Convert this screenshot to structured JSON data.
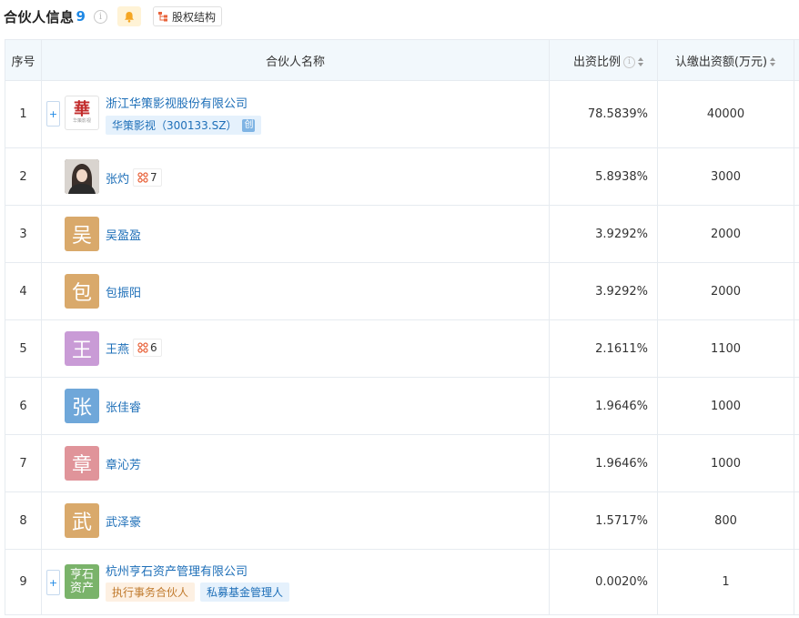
{
  "header": {
    "title": "合伙人信息",
    "count": "9",
    "info_glyph": "i",
    "structure_label": "股权结构"
  },
  "table": {
    "columns": {
      "index": "序号",
      "name": "合伙人名称",
      "ratio": "出资比例",
      "amount": "认缴出资额(万元)"
    },
    "rows": [
      {
        "index": "1",
        "name": "浙江华策影视股份有限公司",
        "avatar_type": "logo",
        "logo_mark": "華",
        "logo_sub": "华策影视",
        "stock_tag": "华策影视（300133.SZ）",
        "board_tag": "创",
        "ratio": "78.5839%",
        "amount": "40000",
        "expandable": true
      },
      {
        "index": "2",
        "name": "张灼",
        "avatar_type": "photo",
        "relation_count": "7",
        "ratio": "5.8938%",
        "amount": "3000"
      },
      {
        "index": "3",
        "name": "吴盈盈",
        "avatar_type": "char",
        "avatar_char": "吴",
        "avatar_color": "#d9a96b",
        "ratio": "3.9292%",
        "amount": "2000"
      },
      {
        "index": "4",
        "name": "包振阳",
        "avatar_type": "char",
        "avatar_char": "包",
        "avatar_color": "#d9a96b",
        "ratio": "3.9292%",
        "amount": "2000"
      },
      {
        "index": "5",
        "name": "王燕",
        "avatar_type": "char",
        "avatar_char": "王",
        "avatar_color": "#c99bd6",
        "relation_count": "6",
        "ratio": "2.1611%",
        "amount": "1100"
      },
      {
        "index": "6",
        "name": "张佳睿",
        "avatar_type": "char",
        "avatar_char": "张",
        "avatar_color": "#6fa7d9",
        "ratio": "1.9646%",
        "amount": "1000"
      },
      {
        "index": "7",
        "name": "章沁芳",
        "avatar_type": "char",
        "avatar_char": "章",
        "avatar_color": "#e0949a",
        "ratio": "1.9646%",
        "amount": "1000"
      },
      {
        "index": "8",
        "name": "武泽豪",
        "avatar_type": "char",
        "avatar_char": "武",
        "avatar_color": "#d9a96b",
        "ratio": "1.5717%",
        "amount": "800"
      },
      {
        "index": "9",
        "name": "杭州亨石资产管理有限公司",
        "avatar_type": "rock",
        "avatar_line1": "亨石",
        "avatar_line2": "资产",
        "avatar_color": "#7ab36a",
        "tags": [
          "执行事务合伙人",
          "私募基金管理人"
        ],
        "ratio": "0.0020%",
        "amount": "1",
        "expandable": true
      }
    ]
  },
  "colors": {
    "link": "#1e6fb8",
    "count": "#1e88e5",
    "header_bg": "#f2f8fc",
    "border": "#e6ebf0"
  }
}
